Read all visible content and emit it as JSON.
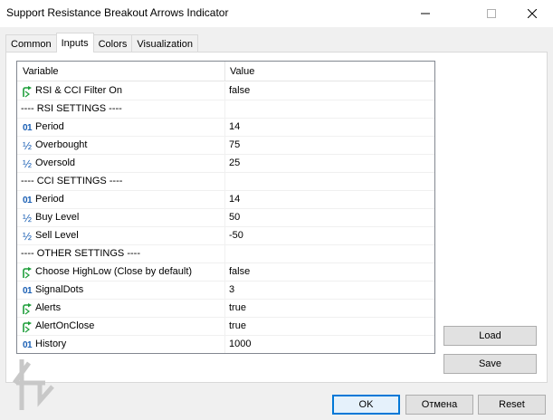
{
  "window": {
    "title": "Support Resistance Breakout Arrows Indicator"
  },
  "tabs": [
    {
      "label": "Common",
      "active": false
    },
    {
      "label": "Inputs",
      "active": true
    },
    {
      "label": "Colors",
      "active": false
    },
    {
      "label": "Visualization",
      "active": false
    }
  ],
  "grid": {
    "col_variable": "Variable",
    "col_value": "Value",
    "rows": [
      {
        "icon": "bool-arrow-icon",
        "name": "RSI & CCI Filter On",
        "value": "false"
      },
      {
        "icon": "",
        "name": "---- RSI SETTINGS ----",
        "value": ""
      },
      {
        "icon": "int-icon",
        "name": "Period",
        "value": "14"
      },
      {
        "icon": "double-icon",
        "name": "Overbought",
        "value": "75"
      },
      {
        "icon": "double-icon",
        "name": "Oversold",
        "value": "25"
      },
      {
        "icon": "",
        "name": "---- CCI SETTINGS ----",
        "value": ""
      },
      {
        "icon": "int-icon",
        "name": "Period",
        "value": "14"
      },
      {
        "icon": "double-icon",
        "name": "Buy Level",
        "value": "50"
      },
      {
        "icon": "double-icon",
        "name": "Sell Level",
        "value": "-50"
      },
      {
        "icon": "",
        "name": "---- OTHER SETTINGS ----",
        "value": ""
      },
      {
        "icon": "bool-arrow-icon",
        "name": "Choose HighLow (Close by default)",
        "value": "false"
      },
      {
        "icon": "int-icon",
        "name": "SignalDots",
        "value": "3"
      },
      {
        "icon": "bool-arrow-icon",
        "name": "Alerts",
        "value": "true"
      },
      {
        "icon": "bool-arrow-icon",
        "name": "AlertOnClose",
        "value": "true"
      },
      {
        "icon": "int-icon",
        "name": "History",
        "value": "1000"
      }
    ]
  },
  "buttons": {
    "load": "Load",
    "save": "Save",
    "ok": "OK",
    "cancel": "Отмена",
    "reset": "Reset"
  },
  "icons": {
    "int_glyph": "01",
    "double_glyph": "½"
  },
  "colors": {
    "accent": "#0078d7",
    "icon_green": "#1e9e3a",
    "icon_blue": "#1a5fb4"
  }
}
